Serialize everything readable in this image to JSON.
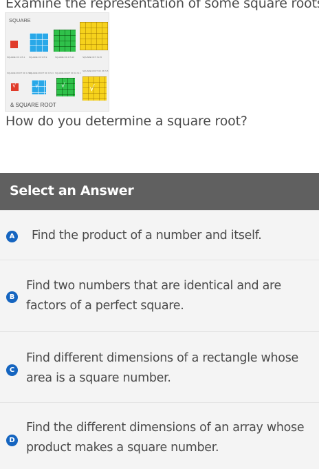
{
  "question": {
    "intro": "Examine the representation of some square roots.",
    "prompt": "How do you determine a square root?"
  },
  "figure": {
    "title": "SQUARE",
    "caption": "& SQUARE ROOT",
    "top_labels": [
      "SQUARE OF 1 IS 1",
      "SQUARE OF 3 IS 9",
      "SQUARE OF 4 IS 16",
      "SQUARE OF 5 IS 25"
    ],
    "root_labels": [
      "SQUARE ROOT OF 1 IS 1",
      "SQUARE ROOT OF 9 IS 3",
      "SQUARE ROOT OF 16 IS 4",
      "SQUARE ROOT OF 25 IS 5"
    ],
    "colors": {
      "red": "#e03b2a",
      "blue": "#29a8e8",
      "green": "#2fc14a",
      "yellow": "#f6d21c"
    }
  },
  "answer_section": {
    "header": "Select an Answer",
    "options": [
      {
        "letter": "A",
        "text": "Find the product of a number and itself."
      },
      {
        "letter": "B",
        "text": "Find two numbers that are identical and are factors of a perfect square."
      },
      {
        "letter": "C",
        "text": "Find different dimensions of a rectangle whose area is a square number."
      },
      {
        "letter": "D",
        "text": "Find the different dimensions of an array whose product makes a square number."
      }
    ],
    "badge_color": "#1565c0"
  }
}
